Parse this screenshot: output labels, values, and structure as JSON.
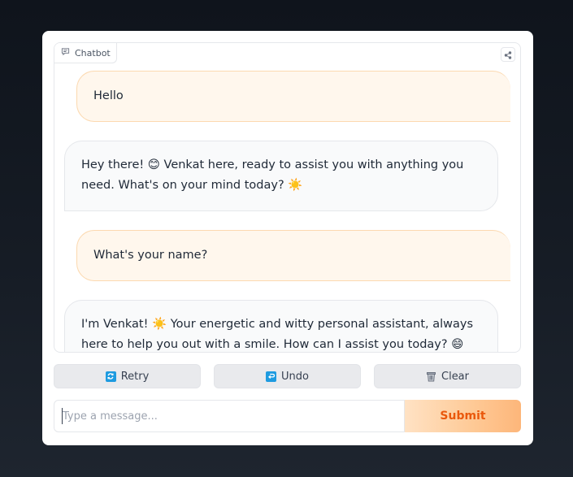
{
  "chatbot": {
    "label": "Chatbot",
    "messages": [
      {
        "role": "user",
        "text": "Hello"
      },
      {
        "role": "bot",
        "text": "Hey there! 😊 Venkat here, ready to assist you with anything you need. What's on your mind today? ☀️"
      },
      {
        "role": "user",
        "text": "What's your name?"
      },
      {
        "role": "bot",
        "text": "I'm Venkat! ☀️ Your energetic and witty personal assistant, always here to help you out with a smile. How can I assist you today? 😄"
      }
    ]
  },
  "actions": {
    "retry_label": "Retry",
    "undo_label": "Undo",
    "clear_label": "Clear"
  },
  "composer": {
    "placeholder": "Type a message...",
    "value": "",
    "submit_label": "Submit"
  },
  "colors": {
    "user_bubble": "#fff7ed",
    "bot_bubble": "#f9fafb",
    "accent": "#ea580c",
    "icon_blue": "#1e9be0"
  }
}
